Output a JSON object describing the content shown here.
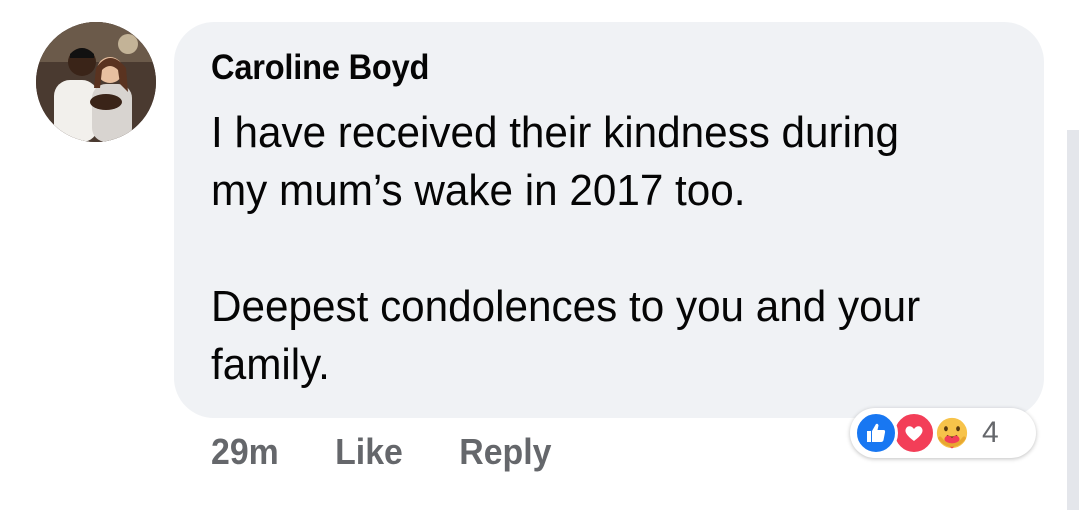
{
  "comment": {
    "author": "Caroline Boyd",
    "paragraphs": [
      "I have received their kindness during\nmy mum’s wake in 2017 too.",
      "Deepest condolences to you and your\nfamily."
    ]
  },
  "actions": {
    "timestamp": "29m",
    "like_label": "Like",
    "reply_label": "Reply"
  },
  "reactions": {
    "icons": [
      "like-icon",
      "love-icon",
      "care-icon"
    ],
    "count": "4"
  },
  "colors": {
    "bubble": "#f0f2f5",
    "meta_text": "#65676b",
    "like_blue": "#1877f2",
    "love_red": "#f33e58"
  }
}
